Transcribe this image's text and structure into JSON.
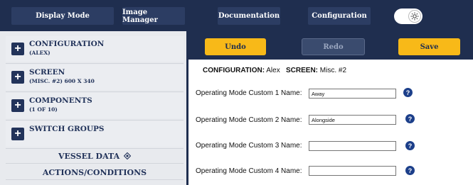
{
  "topbar": {
    "buttons": [
      "Display Mode",
      "Image Manager",
      "Documentation",
      "Configuration"
    ],
    "theme_toggle": {
      "icon": "sun-icon",
      "state": "on"
    }
  },
  "sidebar": {
    "items": [
      {
        "title": "CONFIGURATION",
        "subtitle": "(ALEX)"
      },
      {
        "title": "SCREEN",
        "subtitle": "(MISC. #2) 600 X 340"
      },
      {
        "title": "COMPONENTS",
        "subtitle": "(1 OF 10)"
      },
      {
        "title": "SWITCH GROUPS",
        "subtitle": ""
      }
    ],
    "vessel_data": "VESSEL DATA",
    "vessel_icon": "diamond-move-icon",
    "actions": "ACTIONS/CONDITIONS"
  },
  "toolbar": {
    "undo": "Undo",
    "redo": "Redo",
    "save": "Save"
  },
  "header": {
    "config_label": "CONFIGURATION:",
    "config_value": "Alex",
    "screen_label": "SCREEN:",
    "screen_value": "Misc. #2"
  },
  "fields": [
    {
      "label": "Operating Mode Custom 1 Name:",
      "value": "Away",
      "help": "?"
    },
    {
      "label": "Operating Mode Custom 2 Name:",
      "value": "Alongside",
      "help": "?"
    },
    {
      "label": "Operating Mode Custom 3 Name:",
      "value": "",
      "help": "?"
    },
    {
      "label": "Operating Mode Custom 4 Name:",
      "value": "",
      "help": "?"
    }
  ],
  "colors": {
    "navy": "#1f2e4f",
    "accent": "#f8b918",
    "help": "#1c3f8a"
  }
}
